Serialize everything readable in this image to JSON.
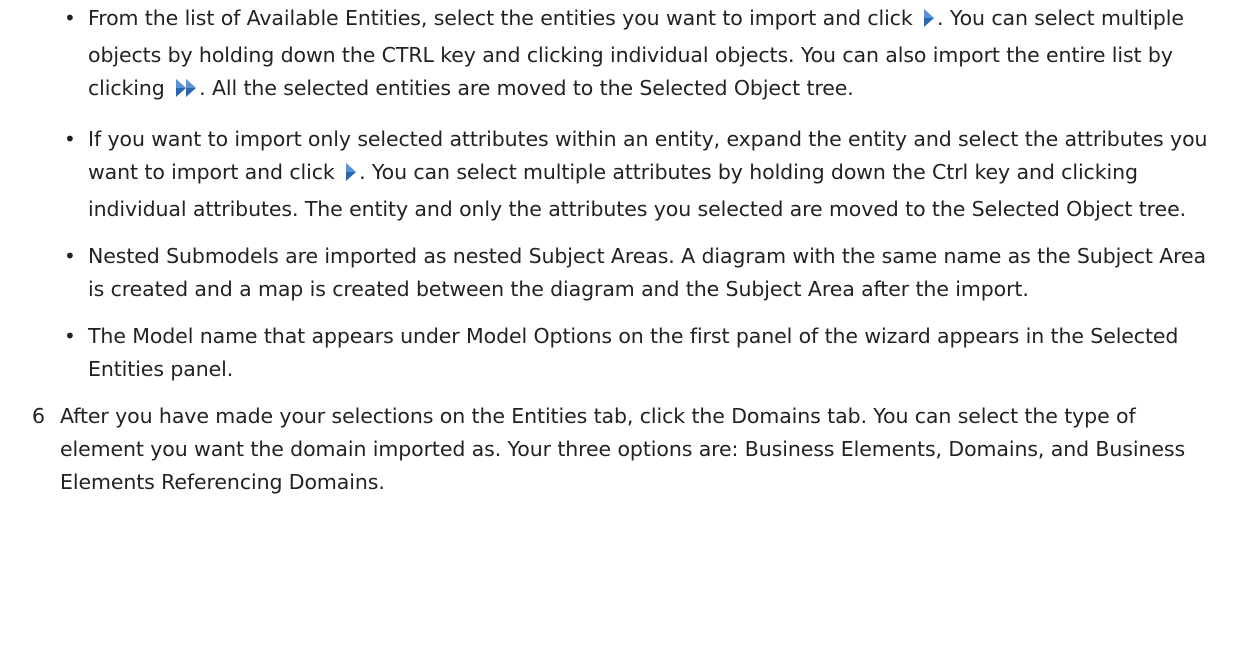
{
  "bullets": [
    {
      "parts": [
        "From the list of Available  Entities,  select the entities you want to import and click ",
        ". You can select multiple objects by holding down the CTRL key and clicking individual objects. You can also import the entire list by clicking ",
        ". All the selected entities are moved to the Selected Object tree."
      ]
    },
    {
      "parts": [
        "If you want to import only selected attributes within an entity, expand the entity and select the attributes you want to import and click ",
        ". You can select multiple attributes by holding down the Ctrl key and clicking individual attributes. The entity and only the attributes you selected are moved to the Selected Object tree."
      ]
    },
    {
      "text": "Nested Submodels are imported as nested Subject Areas. A diagram with the same name as the Subject Area is created and a map is created between the diagram and the Subject Area after the import."
    },
    {
      "text": "The Model name that appears under Model Options on the first panel of the wizard appears in the Selected Entities panel."
    }
  ],
  "step": {
    "number": "6",
    "text": "After you have made your selections on the Entities tab, click the Domains tab. You can select the type of element you want the domain imported as. Your three options are: Business Elements, Domains, and Business Elements Referencing Domains."
  },
  "icons": {
    "single_arrow": "move-right-icon",
    "double_arrow": "move-all-right-icon",
    "arrow_color": "#2b67b0"
  }
}
